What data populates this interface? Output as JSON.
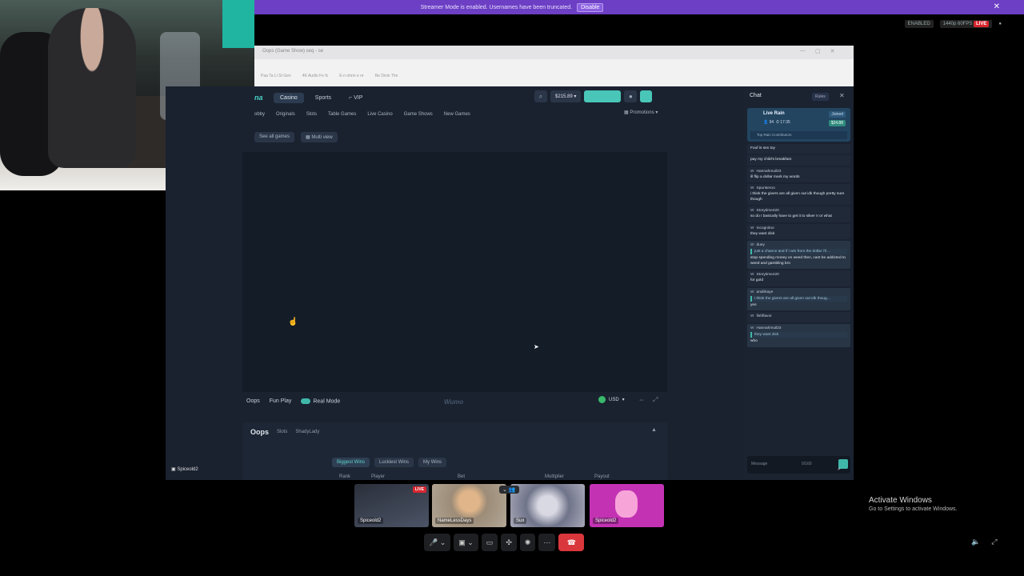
{
  "banner": {
    "text": "Streamer Mode is enabled. Usernames have been truncated.",
    "button": "Disable"
  },
  "status": {
    "enabled": "ENABLED",
    "quality": "1440p 60FPS",
    "live": "LIVE"
  },
  "browser": {
    "tab": "Oops (Game Show) seq - se",
    "address": "",
    "bookmarks": [
      "Paa Ta Li St Gen",
      "4K Audio Fe fc",
      "E-n ohnn e re",
      "Re Divin The"
    ]
  },
  "nav": {
    "logo": "na",
    "tabs": [
      "Casino",
      "Sports",
      "VIP"
    ],
    "balance": "$215.89"
  },
  "subnav": {
    "items": [
      "obby",
      "Originals",
      "Slots",
      "Table Games",
      "Live Casino",
      "Game Shows",
      "New Games"
    ],
    "promotions": "Promotions"
  },
  "games_row": {
    "see_all": "See all games",
    "multi_view": "Multi view"
  },
  "game_footer": {
    "title": "Oops",
    "fun_play": "Fun Play",
    "real_mode": "Real Mode",
    "watermark": "Wumo",
    "currency": "USD"
  },
  "oops_panel": {
    "title": "Oops",
    "tag1": "Slots",
    "tag2": "ShadyLady",
    "tabs": [
      "Biggest Wins",
      "Luckiest Wins",
      "My Wins"
    ],
    "columns": [
      "Rank",
      "Player",
      "Bet",
      "Multiplier",
      "Payout"
    ]
  },
  "chat": {
    "title": "Chat",
    "rules": "Rules",
    "rain": {
      "title": "Live Rain",
      "users": "94",
      "timer": "17:35",
      "joined": "Joined",
      "amount": "$24.88",
      "contributors": "Top Rain Contributors"
    },
    "messages": [
      {
        "user": "",
        "text": "Fouf is sex toy",
        "quote": ""
      },
      {
        "user": "",
        "text": "pay my child's breakfast",
        "quote": ""
      },
      {
        "user": "Hannahmuil23",
        "text": "ill flip a dollar mark my words",
        "quote": ""
      },
      {
        "user": "Spunkeroo",
        "text": "i think the givers are all given out idk though pretty sure though",
        "quote": ""
      },
      {
        "user": "Storytime420",
        "text": "so do I basically have to get it to silver II or what",
        "quote": ""
      },
      {
        "user": "Incognitoo",
        "text": "they want dick",
        "quote": ""
      },
      {
        "user": "duey",
        "text": "stop spending money on weed then, cant be addicted to weed and gambling bro",
        "quote": "just a chance and if i win from the dollar i'll ..."
      },
      {
        "user": "Storytime420",
        "text": "for gold",
        "quote": ""
      },
      {
        "user": "andirkaye",
        "text": "yes",
        "quote": "i think the givers are all given out idk thoug..."
      },
      {
        "user": "fishflavor",
        "text": "",
        "quote": ""
      },
      {
        "user": "Hannahmuil23",
        "text": "who",
        "quote": "they want dick"
      }
    ],
    "input_placeholder": "Message",
    "counter": "0/160"
  },
  "discord": {
    "streamer": "Spiceold2",
    "tiles": [
      {
        "label": "Spiceold2",
        "badge": "LIVE"
      },
      {
        "label": "NameLessDays"
      },
      {
        "label": "Sux"
      },
      {
        "label": "Spiceold2"
      }
    ]
  },
  "activate": {
    "title": "Activate Windows",
    "subtitle": "Go to Settings to activate Windows."
  },
  "icons": [
    "search-icon",
    "user-icon",
    "close-icon",
    "mic-icon",
    "camera-icon",
    "screen-share-icon",
    "apps-icon",
    "activity-icon",
    "more-icon",
    "end-call-icon",
    "volume-icon",
    "fullscreen-icon"
  ]
}
